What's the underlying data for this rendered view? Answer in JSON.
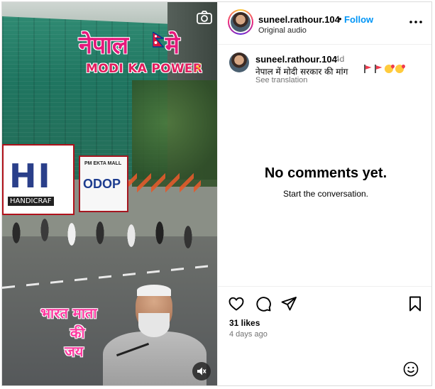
{
  "video": {
    "overlay_title": "नेपाल",
    "overlay_title_suffix": "मे",
    "overlay_subtitle": "MODI KA POWER",
    "overlay_bottom_line1": "भारत माता",
    "overlay_bottom_line2": "की",
    "overlay_bottom_line3": "जय",
    "sign_left_text": "HI",
    "sign_left_small": "HANDICRAF",
    "sign_right_small": "PM EKTA MALL",
    "sign_right_big": "ODOP"
  },
  "header": {
    "username": "suneel.rathour.104",
    "separator": "•",
    "follow_label": "Follow",
    "audio_label": "Original audio"
  },
  "caption": {
    "username": "suneel.rathour.104",
    "time": "4d",
    "text": "नेपाल में मोदी सरकार की मांग",
    "see_translation": "See translation"
  },
  "comments": {
    "empty_title": "No comments yet.",
    "empty_subtitle": "Start the conversation."
  },
  "stats": {
    "likes": "31 likes",
    "posted": "4 days ago"
  },
  "icons": {
    "like": "heart-icon",
    "comment": "comment-icon",
    "share": "send-icon",
    "save": "bookmark-icon",
    "emoji": "emoji-icon",
    "more": "more-icon",
    "camera": "camera-icon",
    "mute": "muted-speaker-icon"
  },
  "colors": {
    "follow": "#0095f6",
    "overlay_pink": "#e6197c",
    "secondary_text": "#737373"
  }
}
